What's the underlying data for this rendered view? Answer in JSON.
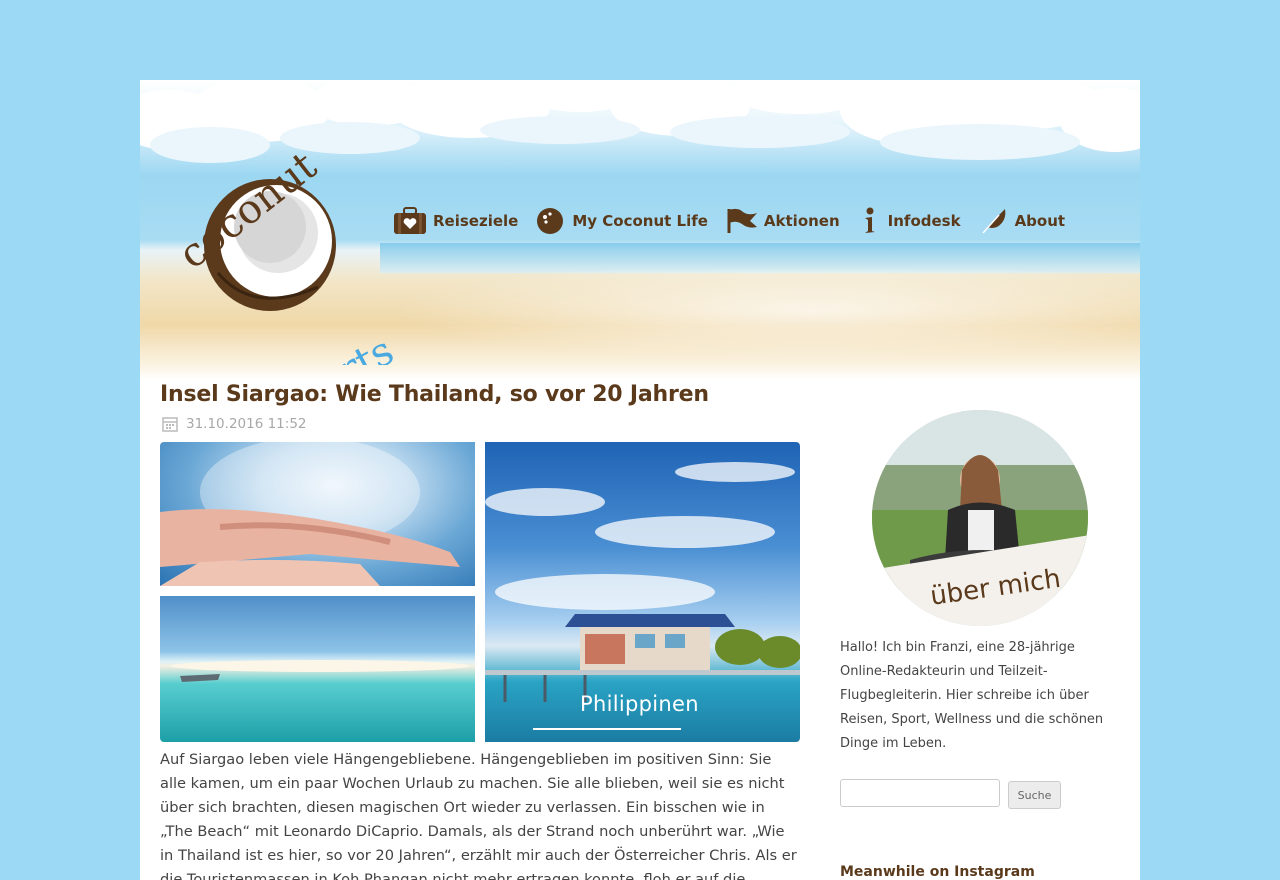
{
  "site": {
    "logo_top": "coconut",
    "logo_bottom": "sports"
  },
  "nav": [
    {
      "label": "Reiseziele",
      "icon": "suitcase-icon"
    },
    {
      "label": "My Coconut Life",
      "icon": "coconut-icon"
    },
    {
      "label": "Aktionen",
      "icon": "flag-icon"
    },
    {
      "label": "Infodesk",
      "icon": "info-icon"
    },
    {
      "label": "About",
      "icon": "feather-icon"
    }
  ],
  "post": {
    "title": "Insel Siargao: Wie Thailand, so vor 20 Jahren",
    "date": "31.10.2016 11:52",
    "image_caption": "Philippinen",
    "body": "Auf Siargao leben viele Hängengebliebene. Hängengeblieben im positiven Sinn: Sie alle kamen, um ein paar Wochen Urlaub zu machen. Sie alle blieben, weil sie es nicht über sich brachten, diesen magischen Ort wieder zu verlassen. Ein bisschen wie in „The Beach“ mit Leonardo DiCaprio. Damals, als der Strand noch unberührt war. „Wie in Thailand ist es hier, so vor 20 Jahren“, erzählt mir auch der Österreicher Chris. Als er die Touristenmassen in Koh Phangan nicht mehr ertragen konnte, floh er auf die Philippinen."
  },
  "sidebar": {
    "about_label": "über mich",
    "about_text": "Hallo! Ich bin Franzi, eine 28-jährige Online-Redakteurin und Teilzeit-Flugbegleiterin. Hier schreibe ich über Reisen, Sport, Wellness und die schönen Dinge im Leben.",
    "search_placeholder": "",
    "search_button": "Suche",
    "instagram_title": "Meanwhile on Instagram"
  },
  "colors": {
    "background": "#9bd9f5",
    "brand_brown": "#5b3a1c",
    "text": "#444444",
    "date": "#a8a8a8"
  }
}
